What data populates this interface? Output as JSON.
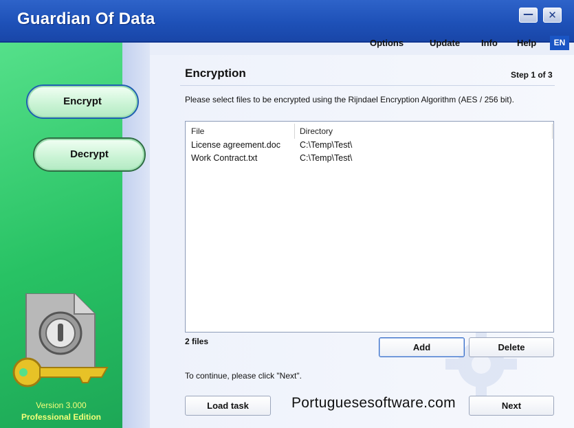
{
  "window": {
    "title": "Guardian Of Data",
    "minimize_glyph": "—",
    "close_glyph": "✕"
  },
  "menu": {
    "options": "Options",
    "update": "Update",
    "info": "Info",
    "help": "Help",
    "language": "EN"
  },
  "sidebar": {
    "encrypt_label": "Encrypt",
    "decrypt_label": "Decrypt",
    "version": "Version 3.000",
    "edition": "Professional Edition"
  },
  "main": {
    "title": "Encryption",
    "step": "Step 1 of 3",
    "description": "Please select files to be encrypted using the Rijndael Encryption Algorithm (AES / 256 bit).",
    "columns": [
      "File",
      "Directory"
    ],
    "files": [
      {
        "file": "License agreement.doc",
        "directory": "C:\\Temp\\Test\\"
      },
      {
        "file": "Work Contract.txt",
        "directory": "C:\\Temp\\Test\\"
      }
    ],
    "file_count": "2 files",
    "add_label": "Add",
    "delete_label": "Delete",
    "hint": "To continue, please click \"Next\".",
    "load_task_label": "Load task",
    "next_label": "Next"
  },
  "watermark": "Portuguesesoftware.com",
  "colors": {
    "titlebar": "#2e63c9",
    "sidebar": "#28c264",
    "accent": "#1a55c4",
    "version_text": "#f5ff7a"
  }
}
